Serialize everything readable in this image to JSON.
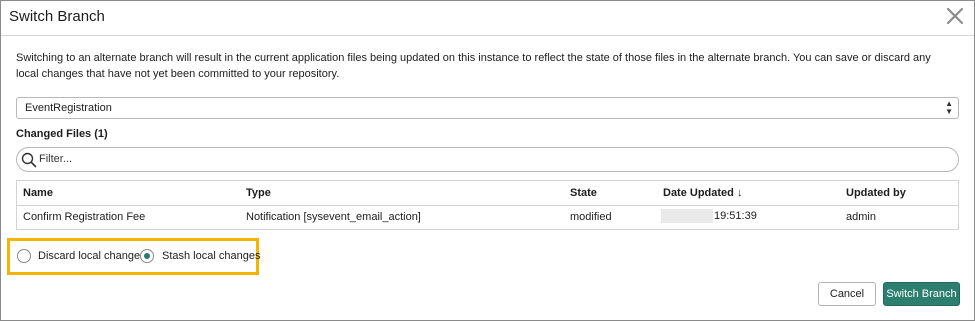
{
  "dialog": {
    "title": "Switch Branch",
    "close_icon": "close-icon",
    "description": "Switching to an alternate branch will result in the current application files being updated on this instance to reflect the state of those files in the alternate branch. You can save or discard any local changes that have not yet been committed to your repository.",
    "branch_select": {
      "value": "EventRegistration"
    },
    "changed_files_label": "Changed Files (1)",
    "filter": {
      "placeholder": "Filter..."
    },
    "table": {
      "columns": [
        "Name",
        "Type",
        "State",
        "Date Updated",
        "Updated by"
      ],
      "sort_indicator": "↓",
      "rows": [
        {
          "name": "Confirm Registration Fee",
          "type": "Notification [sysevent_email_action]",
          "state": "modified",
          "date_time": "19:51:39",
          "updated_by": "admin"
        }
      ]
    },
    "options": [
      {
        "label": "Discard local changes",
        "selected": false
      },
      {
        "label": "Stash local changes",
        "selected": true
      }
    ],
    "buttons": {
      "cancel": "Cancel",
      "primary": "Switch Branch"
    },
    "colors": {
      "primary": "#2c7f6f",
      "highlight": "#f5b400"
    }
  }
}
